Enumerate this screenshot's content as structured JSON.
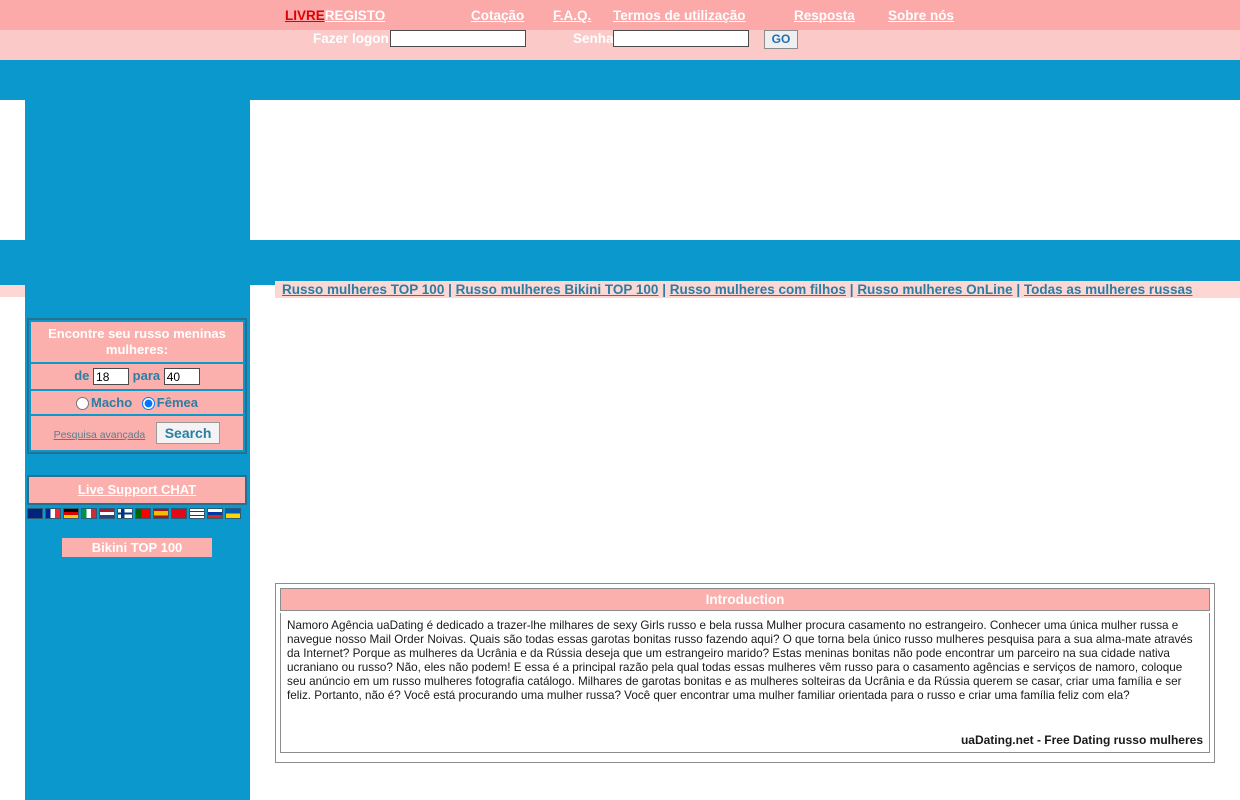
{
  "header": {
    "logo_free": "LIVRE",
    "logo_register": "REGISTO",
    "nav": [
      {
        "label": "Cotação",
        "name": "nav-cotacao"
      },
      {
        "label": "F.A.Q.",
        "name": "nav-faq"
      },
      {
        "label": "Termos de utilização",
        "name": "nav-termos"
      },
      {
        "label": "Resposta",
        "name": "nav-resposta"
      },
      {
        "label": "Sobre nós",
        "name": "nav-sobre-nos"
      }
    ]
  },
  "login": {
    "username_label": "Fazer logon",
    "username_value": "",
    "username_placeholder": "",
    "password_label": "Senha",
    "password_value": "",
    "password_placeholder": "",
    "go_label": "GO"
  },
  "sidebar": {
    "search_title": "Encontre seu russo meninas mulheres:",
    "age_from_label": "de",
    "age_from_value": "18",
    "age_to_label": "para",
    "age_to_value": "40",
    "gender_male": "Macho",
    "gender_female": "Fêmea",
    "gender_selected": "Fêmea",
    "advanced_link": "Pesquisa avançada",
    "search_button": "Search",
    "chat_label": "Live Support CHAT",
    "bikini_label": "Bikini TOP 100",
    "flags": [
      {
        "name": "flag-uk",
        "colors": [
          "#00247d",
          "#ffffff",
          "#cf142b"
        ]
      },
      {
        "name": "flag-france",
        "colors": [
          "#002395",
          "#ffffff",
          "#ed2939"
        ]
      },
      {
        "name": "flag-germany",
        "colors": [
          "#000000",
          "#dd0000",
          "#ffce00"
        ]
      },
      {
        "name": "flag-italy",
        "colors": [
          "#009246",
          "#ffffff",
          "#ce2b37"
        ]
      },
      {
        "name": "flag-netherlands",
        "colors": [
          "#ae1c28",
          "#ffffff",
          "#21468b"
        ]
      },
      {
        "name": "flag-finland",
        "colors": [
          "#ffffff",
          "#003580",
          "#ffffff"
        ]
      },
      {
        "name": "flag-portugal",
        "colors": [
          "#006600",
          "#ff0000",
          "#ffd700"
        ]
      },
      {
        "name": "flag-spain",
        "colors": [
          "#aa151b",
          "#f1bf00",
          "#aa151b"
        ]
      },
      {
        "name": "flag-turkey",
        "colors": [
          "#e30a17",
          "#ffffff",
          "#e30a17"
        ]
      },
      {
        "name": "flag-israel",
        "colors": [
          "#ffffff",
          "#0038b8",
          "#ffffff"
        ]
      },
      {
        "name": "flag-russia",
        "colors": [
          "#ffffff",
          "#0039a6",
          "#d52b1e"
        ]
      },
      {
        "name": "flag-ukraine",
        "colors": [
          "#005bbb",
          "#ffd500",
          "#005bbb"
        ]
      }
    ]
  },
  "toplinks": [
    {
      "label": "Russo mulheres TOP 100",
      "name": "link-top-100"
    },
    {
      "label": "Russo mulheres Bikini TOP 100",
      "name": "link-bikini-top-100"
    },
    {
      "label": "Russo mulheres com filhos",
      "name": "link-com-filhos"
    },
    {
      "label": "Russo mulheres OnLine",
      "name": "link-online"
    },
    {
      "label": "Todas as mulheres russas",
      "name": "link-todas"
    }
  ],
  "introduction": {
    "title": "Introduction",
    "body": "Namoro Agência uaDating é dedicado a trazer-lhe milhares de sexy Girls russo e bela russa Mulher procura casamento no estrangeiro. Conhecer uma única mulher russa e navegue nosso Mail Order Noivas. Quais são todas essas garotas bonitas russo fazendo aqui? O que torna bela único russo mulheres pesquisa para a sua alma-mate através da Internet? Porque as mulheres da Ucrânia e da Rússia deseja que um estrangeiro marido? Estas meninas bonitas não pode encontrar um parceiro na sua cidade nativa ucraniano ou russo? Não, eles não podem! E essa é a principal razão pela qual todas essas mulheres vêm russo para o casamento agências e serviços de namoro, coloque seu anúncio em um russo mulheres fotografia catálogo. Milhares de garotas bonitas e as mulheres solteiras da Ucrânia e da Rússia querem se casar, criar uma família e ser feliz. Portanto, não é? Você está procurando uma mulher russa? Você quer encontrar uma mulher familiar orientada para o russo e criar uma família feliz com ela?",
    "footer": "uaDating.net - Free Dating russo mulheres"
  },
  "colors": {
    "pink_header": "#fba9a9",
    "pink_light": "#fcc9c9",
    "pink_pale": "#fcd7d3",
    "blue": "#0b98cd",
    "blue_border": "#27708f",
    "link_blue": "#2a7ea3",
    "red": "#e00000"
  }
}
